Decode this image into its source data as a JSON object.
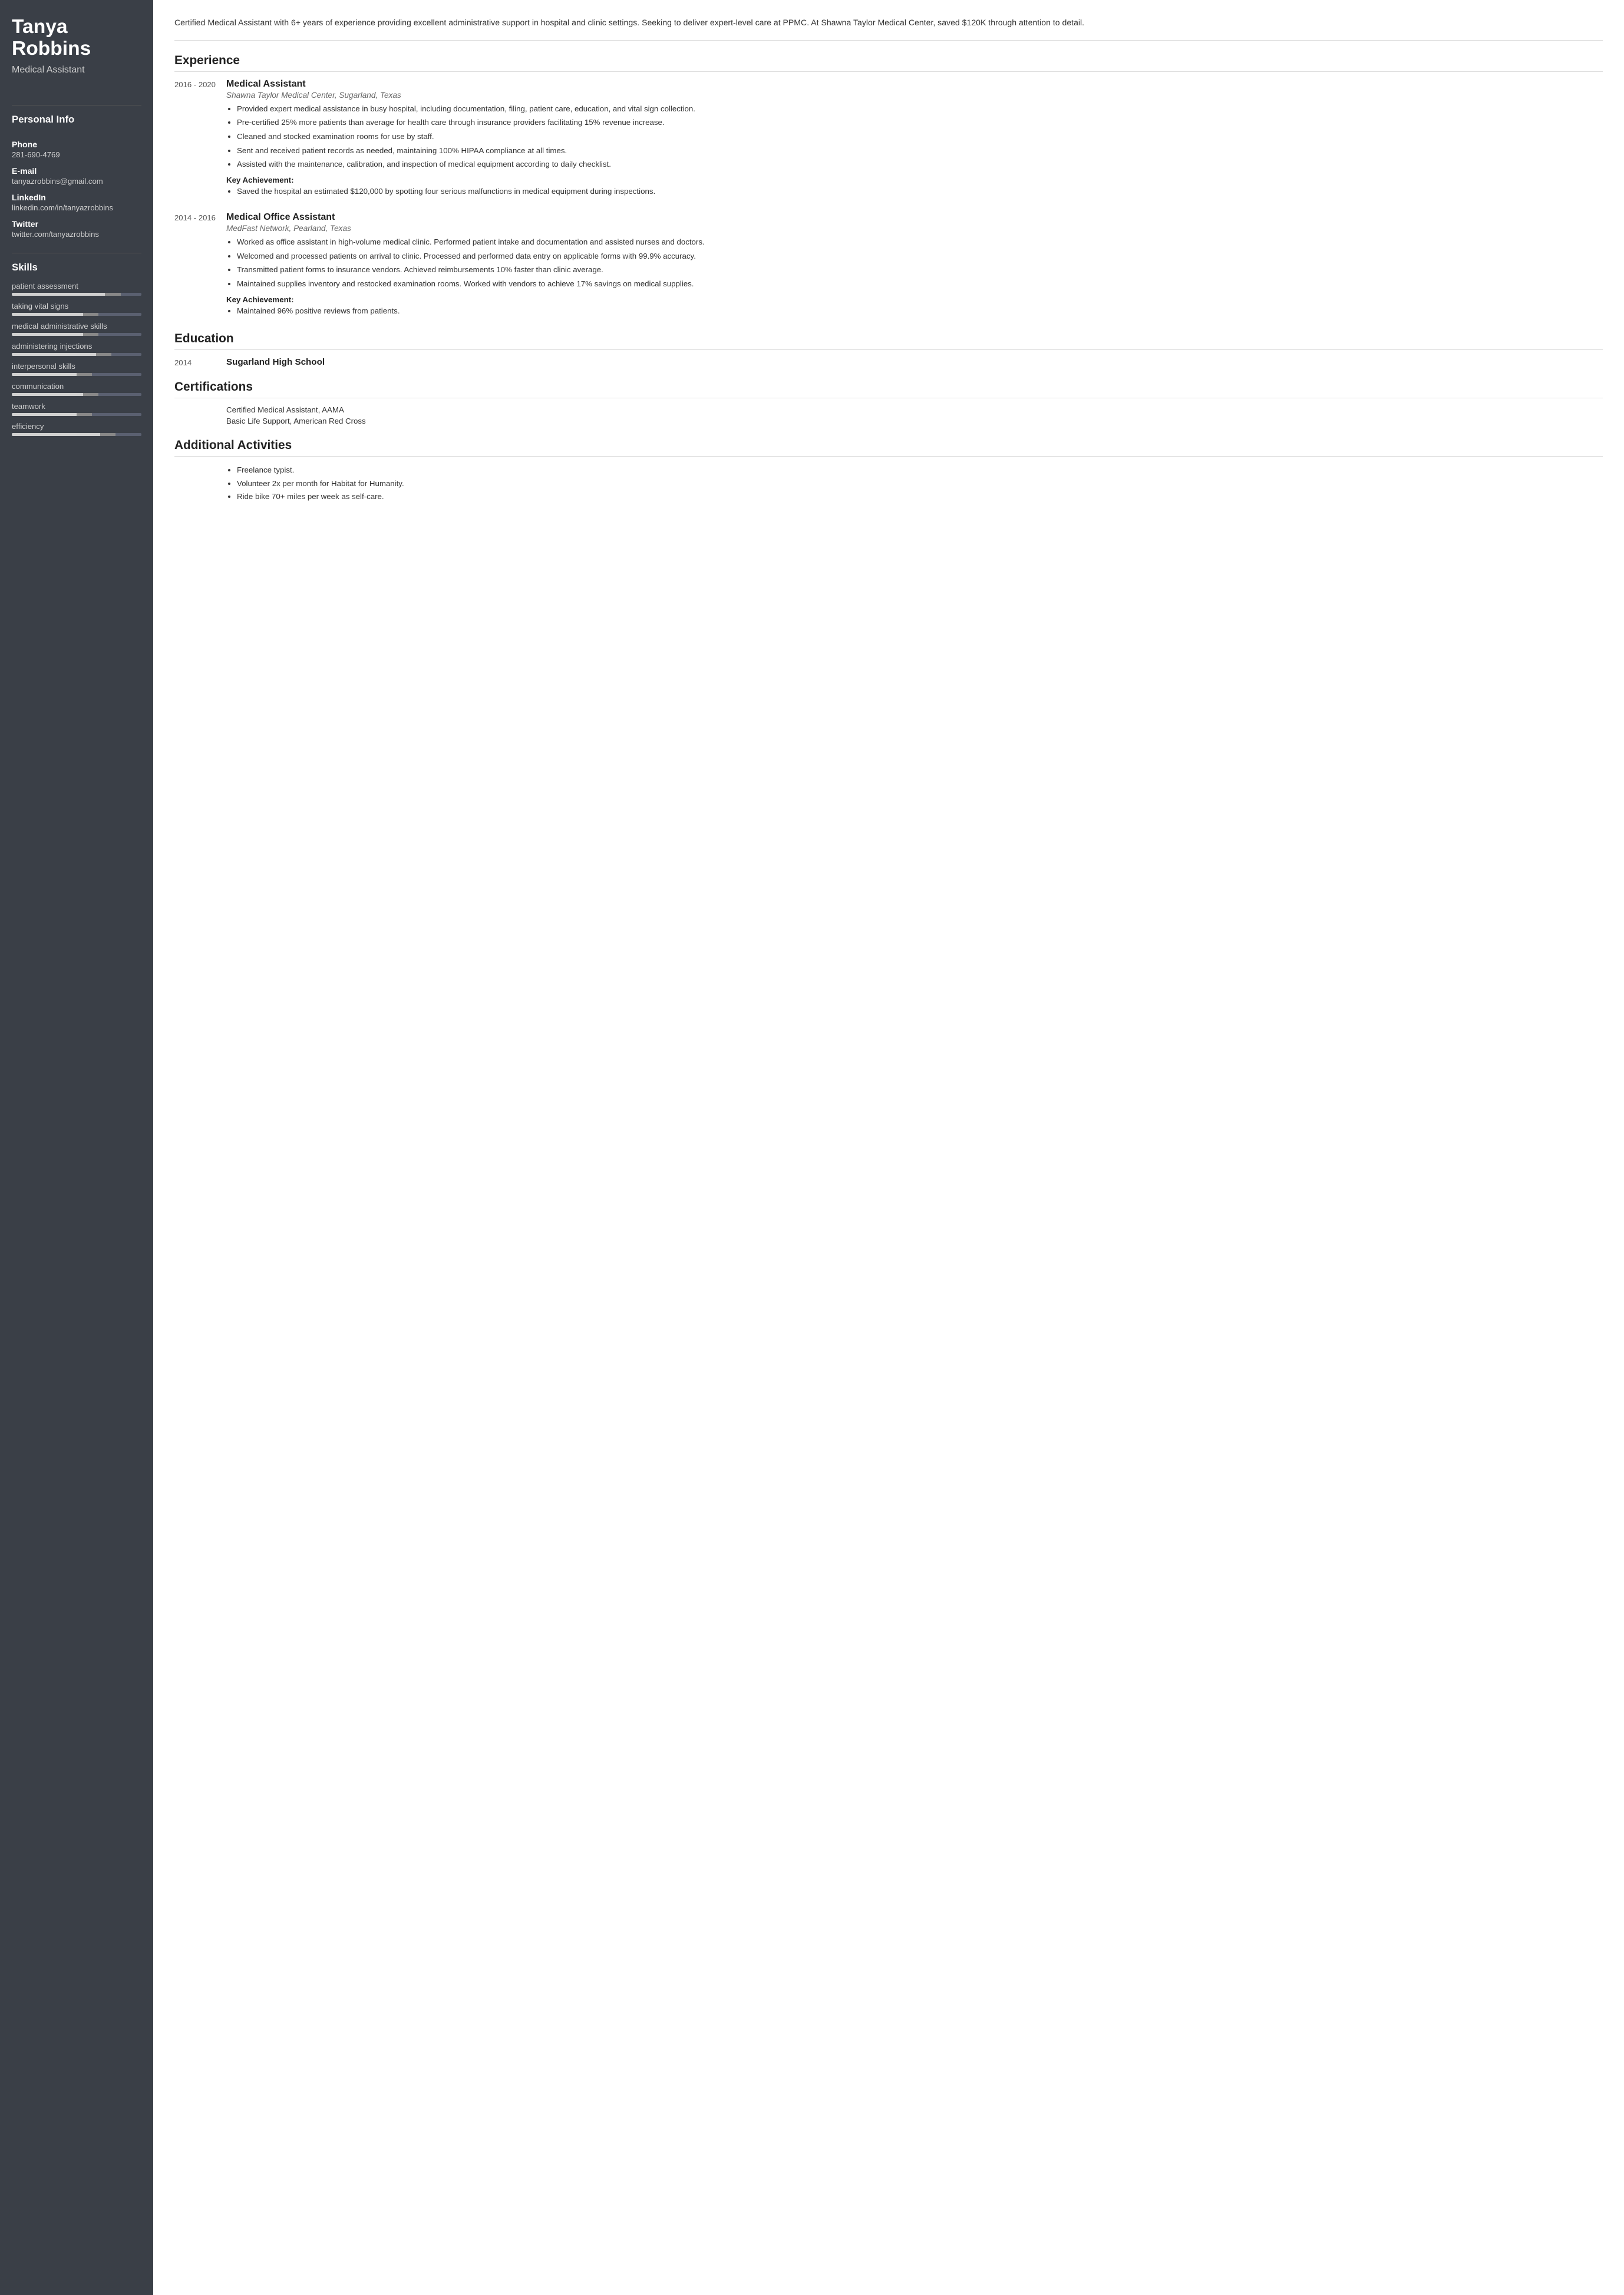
{
  "sidebar": {
    "name_line1": "Tanya",
    "name_line2": "Robbins",
    "title": "Medical Assistant",
    "personal_info_label": "Personal Info",
    "phone_label": "Phone",
    "phone_value": "281-690-4769",
    "email_label": "E-mail",
    "email_value": "tanyazrobbins@gmail.com",
    "linkedin_label": "LinkedIn",
    "linkedin_value": "linkedin.com/in/tanyazrobbins",
    "twitter_label": "Twitter",
    "twitter_value": "twitter.com/tanyazrobbins",
    "skills_label": "Skills",
    "skills": [
      {
        "name": "patient assessment",
        "light_pct": 72,
        "dark_pct": 12
      },
      {
        "name": "taking vital signs",
        "light_pct": 55,
        "dark_pct": 12
      },
      {
        "name": "medical administrative skills",
        "light_pct": 55,
        "dark_pct": 12
      },
      {
        "name": "administering injections",
        "light_pct": 65,
        "dark_pct": 12
      },
      {
        "name": "interpersonal skills",
        "light_pct": 50,
        "dark_pct": 12
      },
      {
        "name": "communication",
        "light_pct": 55,
        "dark_pct": 12
      },
      {
        "name": "teamwork",
        "light_pct": 50,
        "dark_pct": 12
      },
      {
        "name": "efficiency",
        "light_pct": 68,
        "dark_pct": 12
      }
    ]
  },
  "main": {
    "summary": "Certified Medical Assistant with 6+ years of experience providing excellent administrative support in hospital and clinic settings. Seeking to deliver expert-level care at PPMC. At Shawna Taylor Medical Center, saved $120K through attention to detail.",
    "experience_title": "Experience",
    "experience_entries": [
      {
        "dates": "2016 - 2020",
        "title": "Medical Assistant",
        "company": "Shawna Taylor Medical Center, Sugarland, Texas",
        "bullets": [
          "Provided expert medical assistance in busy hospital, including documentation, filing, patient care, education, and vital sign collection.",
          "Pre-certified 25% more patients than average for health care through insurance providers facilitating 15% revenue increase.",
          "Cleaned and stocked examination rooms for use by staff.",
          "Sent and received patient records as needed, maintaining 100% HIPAA compliance at all times.",
          "Assisted with the maintenance, calibration, and inspection of medical equipment according to daily checklist."
        ],
        "key_achievement_label": "Key Achievement:",
        "key_achievement_bullets": [
          "Saved the hospital an estimated $120,000 by spotting four serious malfunctions in medical equipment during inspections."
        ]
      },
      {
        "dates": "2014 - 2016",
        "title": "Medical Office Assistant",
        "company": "MedFast Network, Pearland, Texas",
        "bullets": [
          "Worked as office assistant in high-volume medical clinic. Performed patient intake and documentation and assisted nurses and doctors.",
          "Welcomed and processed patients on arrival to clinic. Processed and performed data entry on applicable forms with 99.9% accuracy.",
          "Transmitted patient forms to insurance vendors. Achieved reimbursements 10% faster than clinic average.",
          "Maintained supplies inventory and restocked examination rooms. Worked with vendors to achieve 17% savings on medical supplies."
        ],
        "key_achievement_label": "Key Achievement:",
        "key_achievement_bullets": [
          "Maintained 96% positive reviews from patients."
        ]
      }
    ],
    "education_title": "Education",
    "education_entries": [
      {
        "year": "2014",
        "school": "Sugarland High School"
      }
    ],
    "certifications_title": "Certifications",
    "certifications": [
      "Certified Medical Assistant, AAMA",
      "Basic Life Support, American Red Cross"
    ],
    "activities_title": "Additional Activities",
    "activities": [
      "Freelance typist.",
      "Volunteer 2x per month for Habitat for Humanity.",
      "Ride bike 70+ miles per week as self-care."
    ]
  }
}
